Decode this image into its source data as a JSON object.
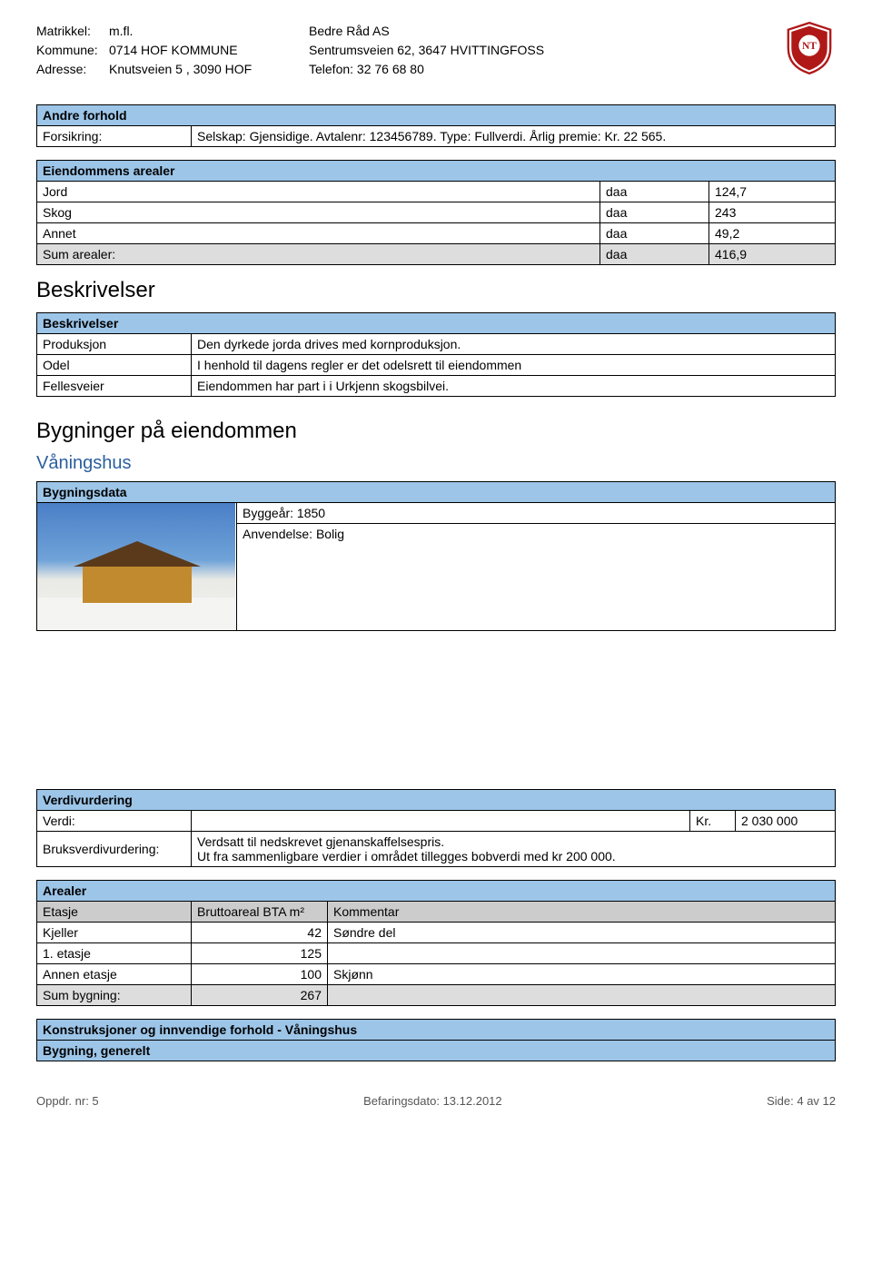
{
  "header": {
    "left": {
      "matrikkel_label": "Matrikkel:",
      "matrikkel_value": "m.fl.",
      "kommune_label": "Kommune:",
      "kommune_value": "0714 HOF KOMMUNE",
      "adresse_label": "Adresse:",
      "adresse_value": "Knutsveien 5 , 3090 HOF"
    },
    "mid": {
      "company": "Bedre Råd AS",
      "address": "Sentrumsveien 62, 3647 HVITTINGFOSS",
      "phone": "Telefon: 32 76 68 80"
    }
  },
  "andre_forhold": {
    "title": "Andre forhold",
    "forsikring_label": "Forsikring:",
    "forsikring_value": "Selskap: Gjensidige.  Avtalenr: 123456789.  Type: Fullverdi.  Årlig premie: Kr. 22 565."
  },
  "eiendommens_arealer": {
    "title": "Eiendommens arealer",
    "rows": [
      {
        "label": "Jord",
        "unit": "daa",
        "value": "124,7"
      },
      {
        "label": "Skog",
        "unit": "daa",
        "value": "243"
      },
      {
        "label": "Annet",
        "unit": "daa",
        "value": "49,2"
      }
    ],
    "sum": {
      "label": "Sum arealer:",
      "unit": "daa",
      "value": "416,9"
    }
  },
  "beskrivelser_h": "Beskrivelser",
  "beskrivelser": {
    "title": "Beskrivelser",
    "rows": [
      {
        "label": "Produksjon",
        "value": "Den dyrkede jorda drives med kornproduksjon."
      },
      {
        "label": "Odel",
        "value": "I henhold til dagens regler er det odelsrett til eiendommen"
      },
      {
        "label": "Fellesveier",
        "value": "Eiendommen har part i i Urkjenn skogsbilvei."
      }
    ]
  },
  "bygninger_h": "Bygninger på eiendommen",
  "vaningshus_h": "Våningshus",
  "bygningsdata": {
    "title": "Bygningsdata",
    "byggear": "Byggeår: 1850",
    "anvendelse": "Anvendelse: Bolig"
  },
  "verdivurdering": {
    "title": "Verdivurdering",
    "verdi_label": "Verdi:",
    "verdi_currency": "Kr.",
    "verdi_amount": "2 030 000",
    "bruks_label": "Bruksverdivurdering:",
    "bruks_value": "Verdsatt til nedskrevet gjenanskaffelsespris.\nUt fra sammenligbare verdier i området tillegges bobverdi med kr 200 000."
  },
  "arealer": {
    "title": "Arealer",
    "col1": "Etasje",
    "col2": "Bruttoareal BTA m²",
    "col3": "Kommentar",
    "rows": [
      {
        "etasje": "Kjeller",
        "bta": "42",
        "kommentar": "Søndre del"
      },
      {
        "etasje": "1. etasje",
        "bta": "125",
        "kommentar": ""
      },
      {
        "etasje": "Annen etasje",
        "bta": "100",
        "kommentar": "Skjønn"
      }
    ],
    "sum": {
      "etasje": "Sum bygning:",
      "bta": "267",
      "kommentar": ""
    }
  },
  "konstruksjoner": {
    "title": "Konstruksjoner og innvendige forhold - Våningshus",
    "sub": "Bygning, generelt"
  },
  "footer": {
    "left": "Oppdr. nr: 5",
    "mid": "Befaringsdato: 13.12.2012",
    "right": "Side: 4 av 12"
  }
}
